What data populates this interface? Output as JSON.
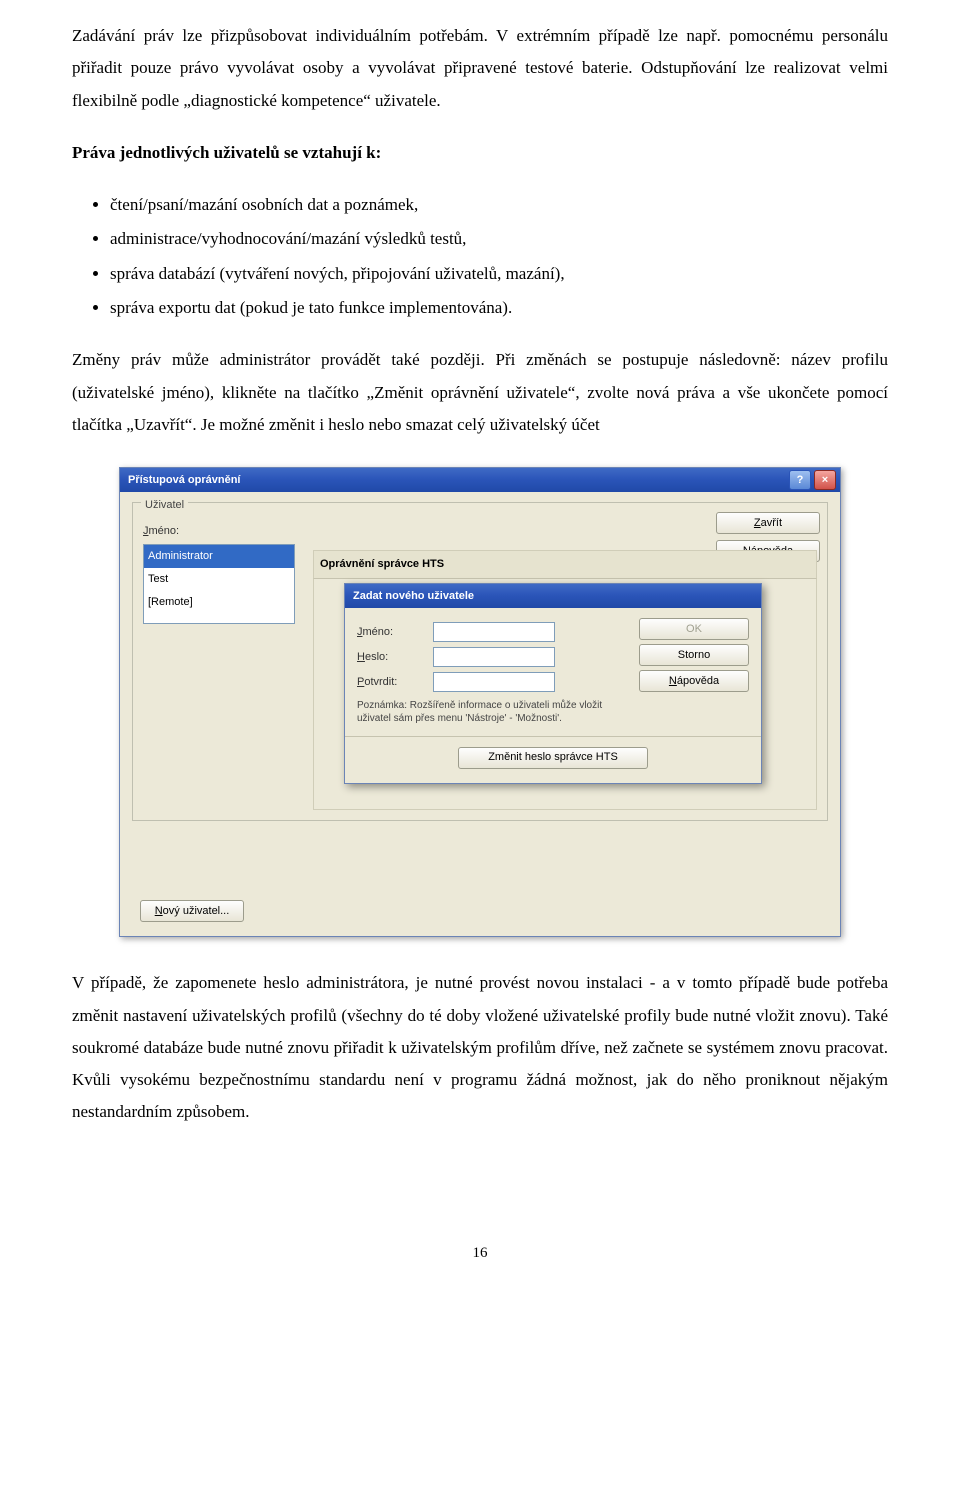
{
  "para1": "Zadávání práv lze přizpůsobovat individuálním potřebám. V extrémním případě lze např. pomocnému personálu přiřadit pouze právo vyvolávat osoby a vyvolávat připravené testové baterie. Odstupňování lze realizovat velmi flexibilně podle „diagnostické kompetence“ uživatele.",
  "rights_heading": "Práva jednotlivých uživatelů se vztahují k:",
  "rights": [
    "čtení/psaní/mazání osobních dat a poznámek,",
    "administrace/vyhodnocování/mazání výsledků testů,",
    "správa databází (vytváření nových, připojování uživatelů, mazání),",
    "správa exportu dat (pokud je tato funkce implementována)."
  ],
  "para2": "Změny práv může administrátor provádět také později. Při změnách se postupuje následovně: název profilu (uživatelské jméno), klikněte na tlačítko „Změnit oprávnění uživatele“, zvolte nová práva a vše ukončete pomocí tlačítka „Uzavřít“. Je možné změnit i heslo nebo smazat celý uživatelský účet",
  "para3": "V případě, že zapomenete heslo administrátora, je nutné provést novou instalaci - a v tomto případě bude potřeba změnit nastavení uživatelských profilů (všechny do té doby vložené uživatelské profily bude nutné vložit znovu). Také soukromé databáze bude nutné znovu přiřadit k uživatelským profilům dříve, než začnete se systémem znovu pracovat. Kvůli vysokému bezpečnostnímu standardu není v programu žádná možnost, jak do něho proniknout nějakým nestandardním způsobem.",
  "page_number": "16",
  "window": {
    "title": "Přístupová oprávnění",
    "help_icon": "?",
    "close_icon": "×",
    "group_user": "Uživatel",
    "user_label": "Jméno:",
    "user_list": [
      "Administrator",
      "Test",
      "[Remote]"
    ],
    "btn_close": "Zavřít",
    "btn_close_key": "Z",
    "btn_help": "Nápověda",
    "btn_help_key": "N",
    "perm_title": "Oprávnění správce HTS",
    "btn_new_user": "Nový uživatel...",
    "btn_new_user_key": "N"
  },
  "subwindow": {
    "title": "Zadat nového uživatele",
    "lbl_name": "Jméno:",
    "lbl_name_key": "J",
    "lbl_pass": "Heslo:",
    "lbl_pass_key": "H",
    "lbl_confirm": "Potvrdit:",
    "lbl_confirm_key": "P",
    "btn_ok": "OK",
    "btn_cancel": "Storno",
    "btn_help": "Nápověda",
    "btn_help_key": "N",
    "note": "Poznámka: Rozšířeně informace o uživateli může vložit uživatel sám přes menu 'Nástroje' - 'Možnosti'.",
    "btn_change_pass": "Změnit heslo správce HTS"
  }
}
